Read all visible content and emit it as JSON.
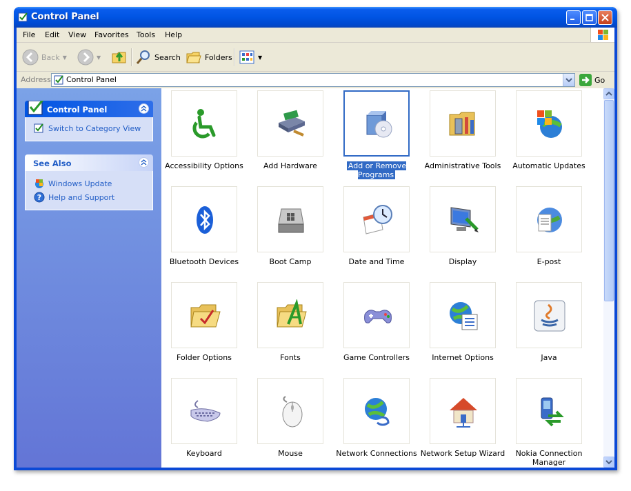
{
  "window": {
    "title": "Control Panel"
  },
  "menu": [
    "File",
    "Edit",
    "View",
    "Favorites",
    "Tools",
    "Help"
  ],
  "toolbar": {
    "back": "Back",
    "search": "Search",
    "folders": "Folders"
  },
  "address": {
    "label": "Address",
    "value": "Control Panel",
    "go": "Go"
  },
  "taskpane": {
    "control_panel": {
      "title": "Control Panel",
      "links": [
        "Switch to Category View"
      ]
    },
    "see_also": {
      "title": "See Also",
      "links": [
        "Windows Update",
        "Help and Support"
      ]
    }
  },
  "items": [
    {
      "label": "Accessibility Options",
      "icon": "accessibility-icon"
    },
    {
      "label": "Add Hardware",
      "icon": "add-hardware-icon"
    },
    {
      "label": "Add or Remove Programs",
      "icon": "add-remove-programs-icon",
      "selected": true
    },
    {
      "label": "Administrative Tools",
      "icon": "administrative-tools-icon"
    },
    {
      "label": "Automatic Updates",
      "icon": "automatic-updates-icon"
    },
    {
      "label": "Bluetooth Devices",
      "icon": "bluetooth-icon"
    },
    {
      "label": "Boot Camp",
      "icon": "boot-camp-icon"
    },
    {
      "label": "Date and Time",
      "icon": "date-time-icon"
    },
    {
      "label": "Display",
      "icon": "display-icon"
    },
    {
      "label": "E-post",
      "icon": "e-post-icon"
    },
    {
      "label": "Folder Options",
      "icon": "folder-options-icon"
    },
    {
      "label": "Fonts",
      "icon": "fonts-icon"
    },
    {
      "label": "Game Controllers",
      "icon": "game-controllers-icon"
    },
    {
      "label": "Internet Options",
      "icon": "internet-options-icon"
    },
    {
      "label": "Java",
      "icon": "java-icon"
    },
    {
      "label": "Keyboard",
      "icon": "keyboard-icon"
    },
    {
      "label": "Mouse",
      "icon": "mouse-icon"
    },
    {
      "label": "Network Connections",
      "icon": "network-connections-icon"
    },
    {
      "label": "Network Setup Wizard",
      "icon": "network-setup-wizard-icon"
    },
    {
      "label": "Nokia Connection Manager",
      "icon": "nokia-connection-manager-icon"
    }
  ],
  "colors": {
    "titlebar": "#0054e3",
    "taskpane": "#7ba2e7",
    "selection": "#316ac5",
    "link": "#215dc6"
  }
}
